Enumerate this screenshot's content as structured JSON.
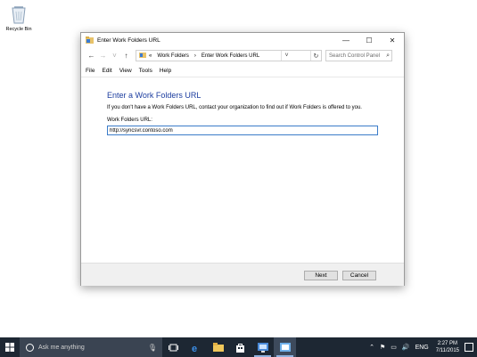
{
  "desktop": {
    "recycle_bin_label": "Recycle Bin"
  },
  "window": {
    "title": "Enter Work Folders URL",
    "controls": {
      "minimize": "—",
      "maximize": "☐",
      "close": "✕"
    },
    "address": {
      "chevron": "«",
      "crumbs": [
        "Work Folders",
        "Enter Work Folders URL"
      ],
      "separator": "›"
    },
    "search_placeholder": "Search Control Panel",
    "menu": [
      "File",
      "Edit",
      "View",
      "Tools",
      "Help"
    ],
    "heading": "Enter a Work Folders URL",
    "description": "If you don't have a Work Folders URL, contact your organization to find out if Work Folders is offered to you.",
    "field_label": "Work Folders URL:",
    "url_value": "http://syncsvr.contoso.com",
    "next_label": "Next",
    "cancel_label": "Cancel"
  },
  "taskbar": {
    "search_placeholder": "Ask me anything",
    "language": "ENG",
    "time": "2:27 PM",
    "date": "7/11/2015"
  },
  "colors": {
    "heading": "#1c3d9f",
    "taskbar": "#1d2733",
    "input_border": "#3b7cc9"
  }
}
